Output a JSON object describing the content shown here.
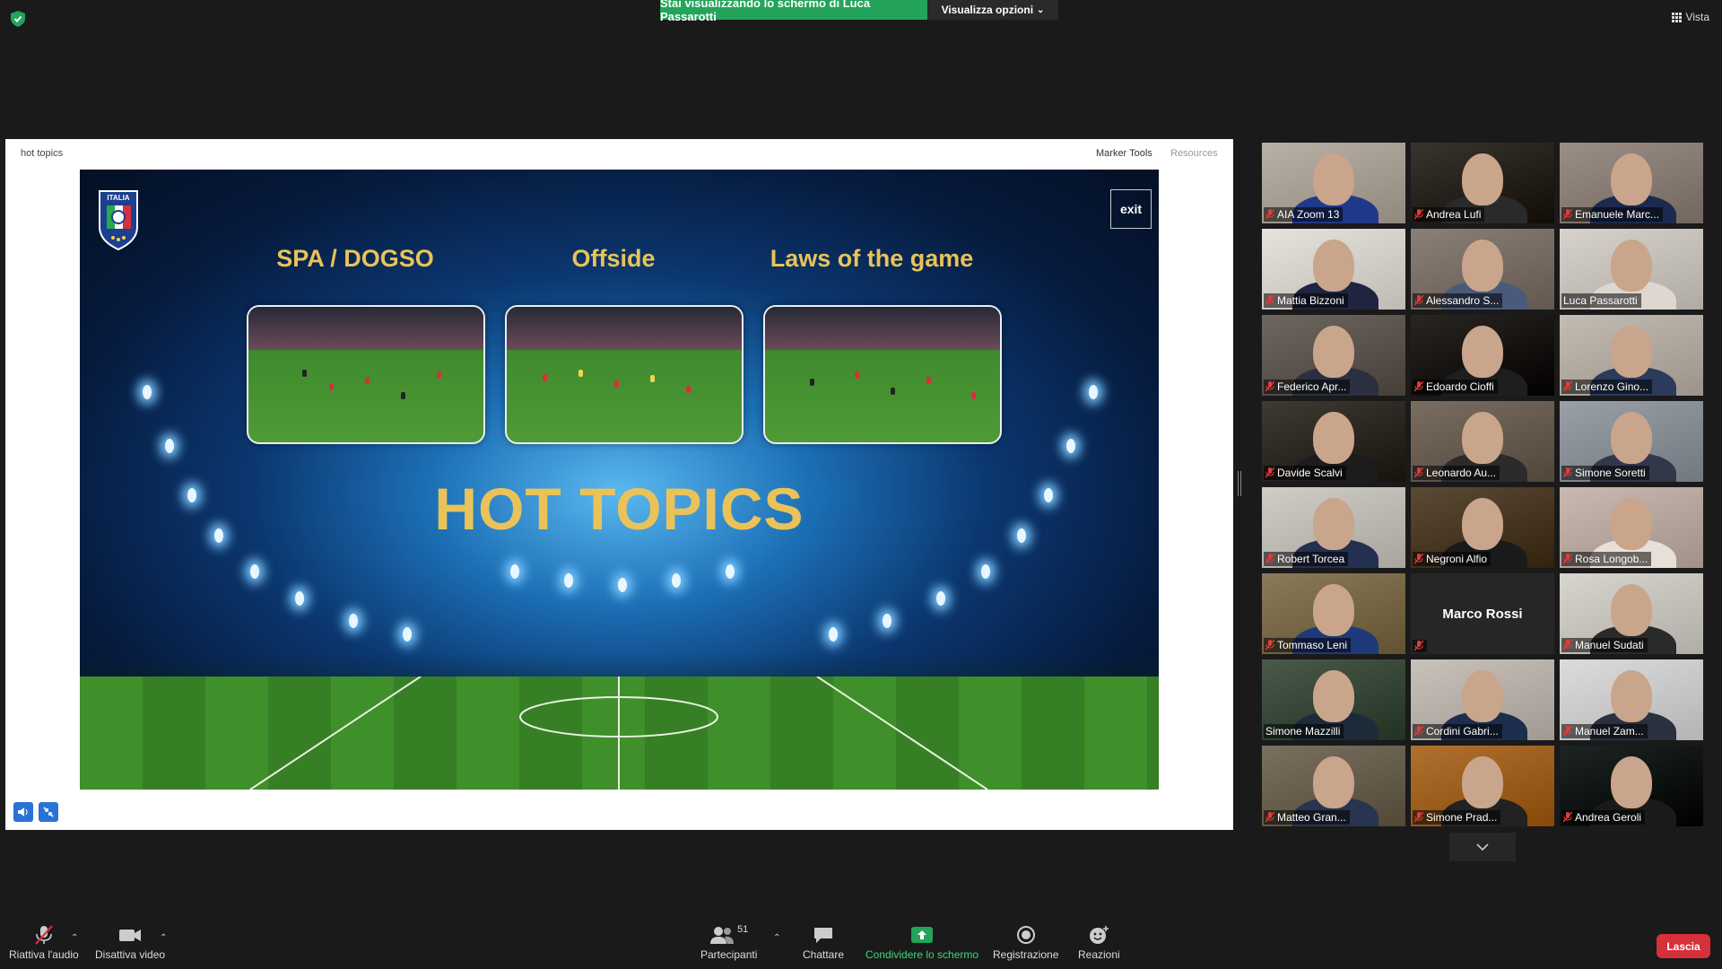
{
  "top": {
    "share_banner": "Stai visualizzando lo schermo di Luca Passarotti",
    "view_options": "Visualizza opzioni",
    "view_mode": "Vista"
  },
  "panel": {
    "title": "hot topics",
    "marker_tools": "Marker Tools",
    "resources": "Resources"
  },
  "slide": {
    "categories": [
      "SPA / DOGSO",
      "Offside",
      "Laws of the game"
    ],
    "headline": "HOT TOPICS",
    "exit": "exit",
    "crest_text": "ITALIA"
  },
  "participants": [
    {
      "name": "AIA Zoom 13",
      "muted": true
    },
    {
      "name": "Andrea Lufi",
      "muted": true
    },
    {
      "name": "Emanuele Marc...",
      "muted": true
    },
    {
      "name": "Mattia Bizzoni",
      "muted": true
    },
    {
      "name": "Alessandro S...",
      "muted": true
    },
    {
      "name": "Luca Passarotti",
      "muted": false,
      "active": true
    },
    {
      "name": "Federico Apr...",
      "muted": true
    },
    {
      "name": "Edoardo Cioffi",
      "muted": true
    },
    {
      "name": "Lorenzo Gino...",
      "muted": true
    },
    {
      "name": "Davide Scalvi",
      "muted": true
    },
    {
      "name": "Leonardo Au...",
      "muted": true
    },
    {
      "name": "Simone Soretti",
      "muted": true
    },
    {
      "name": "Robert Torcea",
      "muted": true
    },
    {
      "name": "Negroni Alfio",
      "muted": true
    },
    {
      "name": "Rosa Longob...",
      "muted": true
    },
    {
      "name": "Tommaso Leni",
      "muted": true
    },
    {
      "name": "Marco Rossi",
      "muted": true,
      "no_video": true
    },
    {
      "name": "Manuel Sudati",
      "muted": true
    },
    {
      "name": "Simone Mazzilli",
      "muted": false
    },
    {
      "name": "Cordini Gabri...",
      "muted": true
    },
    {
      "name": "Manuel Zam...",
      "muted": true
    },
    {
      "name": "Matteo Gran...",
      "muted": true
    },
    {
      "name": "Simone Prad...",
      "muted": true
    },
    {
      "name": "Andrea Geroli",
      "muted": true
    }
  ],
  "toolbar": {
    "unmute": "Riattiva l'audio",
    "stop_video": "Disattiva video",
    "participants": "Partecipanti",
    "participants_count": "51",
    "chat": "Chattare",
    "share_screen": "Condividere lo schermo",
    "record": "Registrazione",
    "reactions": "Reazioni",
    "leave": "Lascia"
  },
  "colors": {
    "share_green": "#23a45a",
    "leave_red": "#d6303b",
    "slide_gold": "#e9c35a",
    "active_speaker": "#d6e35a"
  }
}
